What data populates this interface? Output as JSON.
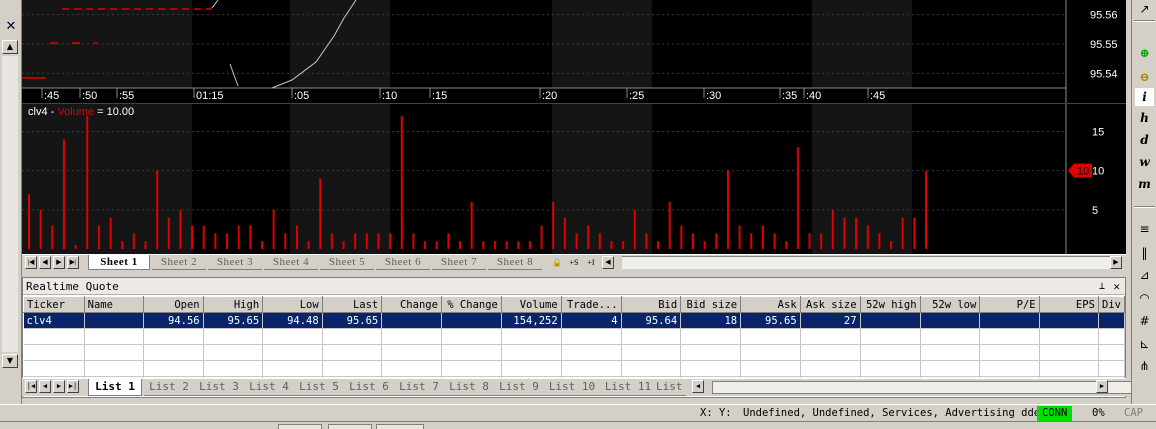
{
  "colors": {
    "chart_bg": "#000000",
    "chart_band": "#151515",
    "grid": "#3a3a3a",
    "volume_bar": "#e00000",
    "price_line": "#c8c8c8",
    "dash_marks": "#e00000",
    "axis_text": "#ffffff",
    "selected_row": "#0a246a",
    "conn_green": "#00e000"
  },
  "left_panel": {
    "close_icon": "✕",
    "up_icon": "▲",
    "down_icon": "▼"
  },
  "price_axis": {
    "labels": [
      "95.56",
      "95.55",
      "95.54"
    ]
  },
  "time_axis": {
    "labels": [
      ":45",
      ":50",
      ":55",
      "01:15",
      ":05",
      ":10",
      ":15",
      ":20",
      ":25",
      ":30",
      ":35",
      ":40",
      ":45"
    ]
  },
  "volume_panel": {
    "ticker": "clv4",
    "separator": " - ",
    "study": "Volume",
    "equals": " = 10.00",
    "axis_labels": [
      "15",
      "10",
      "5"
    ],
    "marker": "10"
  },
  "sheet_tabs": [
    "Sheet 1",
    "Sheet 2",
    "Sheet 3",
    "Sheet 4",
    "Sheet 5",
    "Sheet 6",
    "Sheet 7",
    "Sheet 8"
  ],
  "sheet_tools": [
    "🔒",
    "+S",
    "+I"
  ],
  "nav_icons": [
    "|◀",
    "◀",
    "▶",
    "▶|"
  ],
  "realtime_quote": {
    "title": "Realtime Quote",
    "pin_icon": "⊥",
    "close_icon": "✕",
    "columns": [
      "Ticker",
      "Name",
      "Open",
      "High",
      "Low",
      "Last",
      "Change",
      "% Change",
      "Volume",
      "Trade...",
      "Bid",
      "Bid size",
      "Ask",
      "Ask size",
      "52w high",
      "52w low",
      "P/E",
      "EPS",
      "Div"
    ],
    "rows": [
      [
        "clv4",
        "",
        "94.56",
        "95.65",
        "94.48",
        "95.65",
        "",
        "",
        "154,252",
        "4",
        "95.64",
        "18",
        "95.65",
        "27",
        "",
        "",
        "",
        "",
        ""
      ]
    ]
  },
  "list_tabs": [
    "List 1",
    "List 2",
    "List 3",
    "List 4",
    "List 5",
    "List 6",
    "List 7",
    "List 8",
    "List 9",
    "List 10",
    "List 11",
    "List"
  ],
  "right_toolbar": {
    "icons": [
      "cursor-arrow",
      "zoom-in",
      "zoom-out",
      "info",
      "hour",
      "day",
      "week",
      "month",
      "lines",
      "columns",
      "fan",
      "arc",
      "grid",
      "fib",
      "pitch"
    ],
    "letters": [
      "i",
      "h",
      "d",
      "w",
      "m"
    ]
  },
  "status_bar": {
    "xy": "X: Y:",
    "dde": "Undefined, Undefined, Services, Advertising dde",
    "conn": "CONN",
    "pct": "0%",
    "cap": "CAP"
  },
  "chart_data": {
    "type": "bar",
    "title": "clv4 - Volume = 10.00",
    "series": [
      {
        "name": "Volume",
        "values": [
          7,
          5,
          3,
          14,
          0.5,
          17,
          3,
          4,
          1,
          2,
          1,
          10,
          4,
          5,
          3,
          3,
          2,
          2,
          3,
          3,
          1,
          5,
          2,
          3,
          1,
          9,
          2,
          1,
          2,
          2,
          2,
          2,
          17,
          2,
          1,
          1,
          2,
          1,
          6,
          1,
          1,
          1,
          1,
          1,
          3,
          6,
          4,
          2,
          3,
          2,
          1,
          1,
          5,
          2,
          1,
          6,
          3,
          2,
          1,
          2,
          10,
          3,
          2,
          3,
          2,
          1,
          13,
          2,
          2,
          5,
          4,
          4,
          3,
          2,
          1,
          4,
          4,
          10
        ],
        "color": "#e00000"
      }
    ],
    "ylim": [
      0,
      18
    ],
    "yticks": [
      5,
      10,
      15
    ],
    "current_marker": 10,
    "price_ylim": [
      95.535,
      95.565
    ],
    "price_yticks": [
      95.54,
      95.55,
      95.56
    ]
  }
}
